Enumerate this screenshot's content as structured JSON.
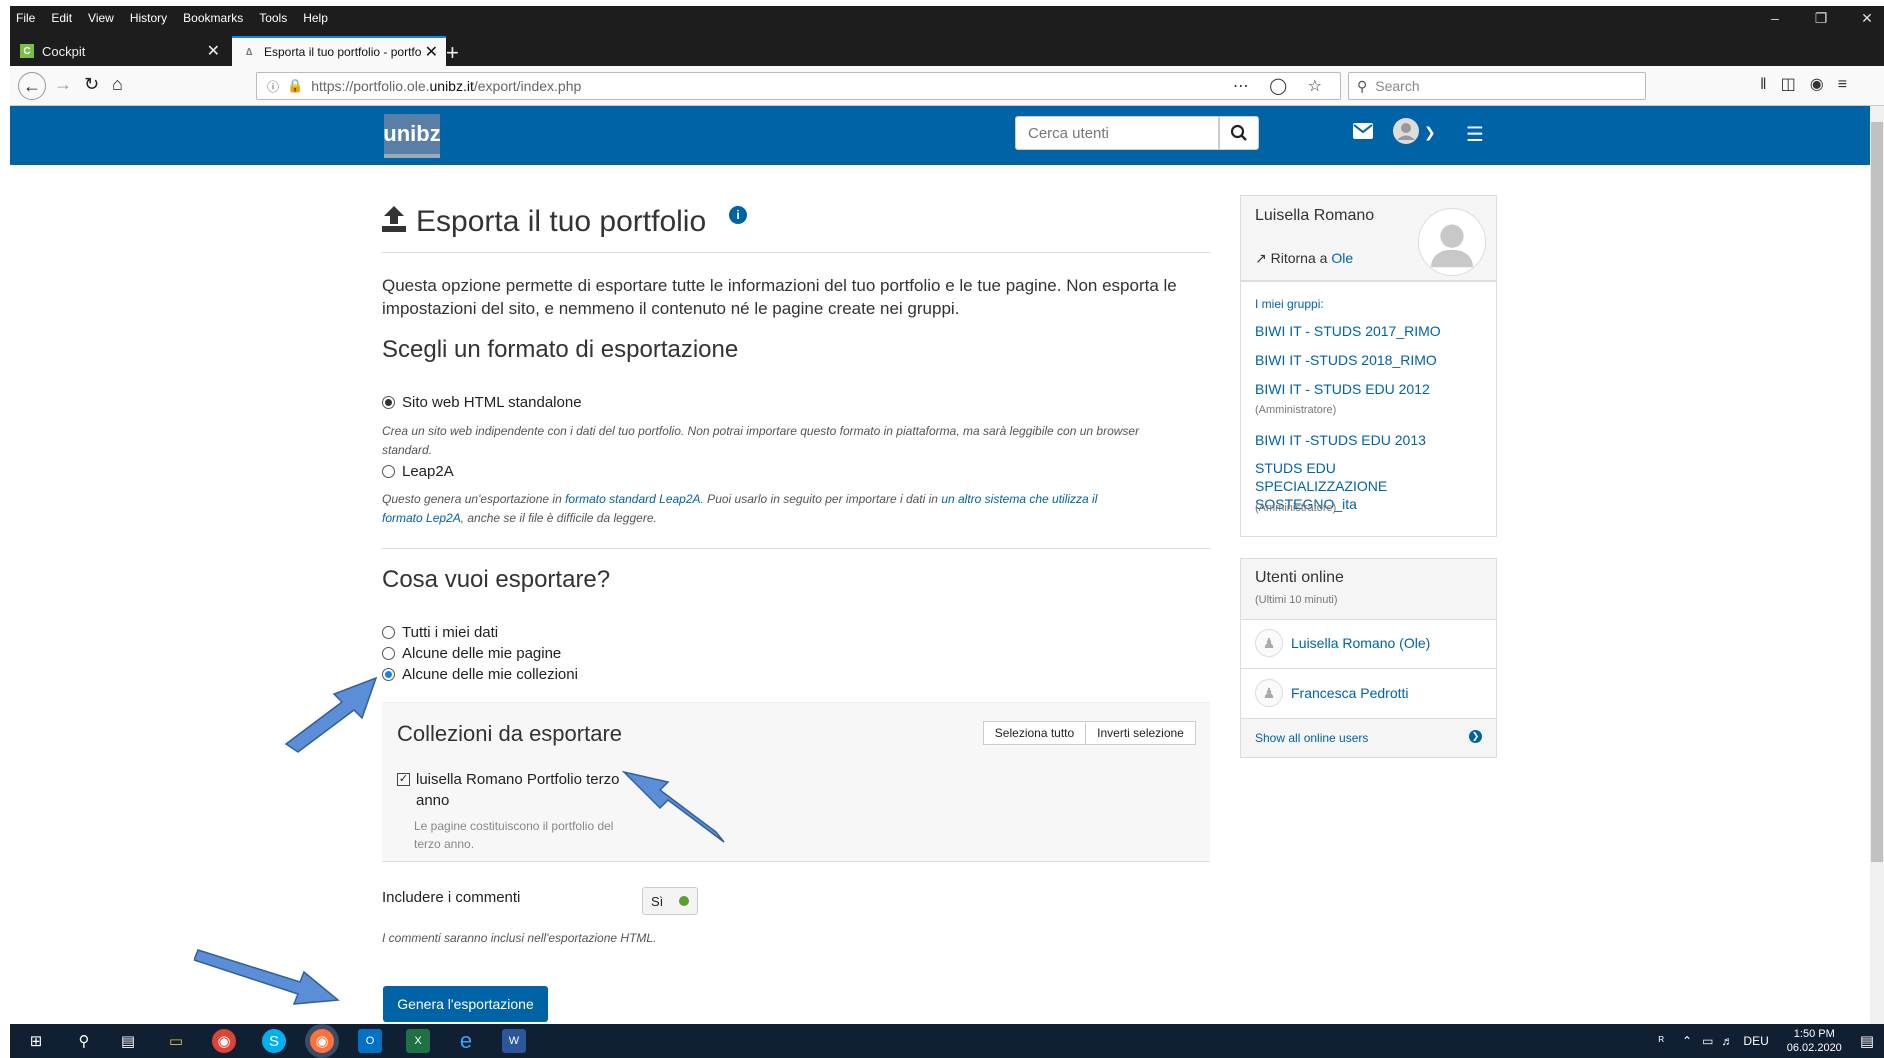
{
  "browser": {
    "menus": [
      "File",
      "Edit",
      "View",
      "History",
      "Bookmarks",
      "Tools",
      "Help"
    ],
    "tabs": [
      {
        "title": "Cockpit"
      },
      {
        "title": "Esporta il tuo portfolio - portfo"
      }
    ],
    "url": {
      "prefix": "https://portfolio.ole.",
      "domain": "unibz.it",
      "path": "/export/index.php"
    },
    "search_placeholder": "Search"
  },
  "site": {
    "logo": "unibz",
    "user_search_placeholder": "Cerca utenti"
  },
  "main": {
    "title": "Esporta il tuo portfolio",
    "intro": "Questa opzione permette di esportare tutte le informazioni del tuo portfolio e le tue pagine. Non esporta le impostazioni del sito, e nemmeno il contenuto né le pagine create nei gruppi.",
    "format_heading": "Scegli un formato di esportazione",
    "format_options": [
      {
        "label": "Sito web HTML standalone",
        "selected": true
      },
      {
        "label": "Leap2A",
        "selected": false
      }
    ],
    "html_desc": "Crea un sito web indipendente con i dati del tuo portfolio. Non potrai importare questo formato in piattaforma, ma sarà leggibile con un browser standard.",
    "leap_desc": {
      "t1": "Questo genera un'esportazione in ",
      "link1": "formato standard Leap2A",
      "t2": ". Puoi usarlo in seguito per importare i dati in ",
      "link2": "un altro sistema che utilizza il formato Lep2A",
      "t3": ", anche se il file è difficile da leggere."
    },
    "what_heading": "Cosa vuoi esportare?",
    "what_options": [
      {
        "label": "Tutti i miei dati",
        "selected": false
      },
      {
        "label": "Alcune delle mie pagine",
        "selected": false
      },
      {
        "label": "Alcune delle mie collezioni",
        "selected": true
      }
    ],
    "collections": {
      "title": "Collezioni da esportare",
      "select_all": "Seleziona tutto",
      "invert": "Inverti selezione",
      "item_label_1": "luisella Romano Portfolio terzo",
      "item_label_2": "anno",
      "item_checked": true,
      "item_desc": "Le pagine costituiscono il portfolio del terzo anno."
    },
    "comments_label": "Includere i commenti",
    "comments_toggle": "Sì",
    "comments_desc": "I commenti saranno inclusi nell'esportazione HTML.",
    "generate_button": "Genera l'esportazione"
  },
  "sidebar": {
    "user_name": "Luisella Romano",
    "return_prefix": "Ritorna a ",
    "return_link": "Ole",
    "groups_label": "I miei gruppi:",
    "groups": [
      {
        "name": "BIWI IT - STUDS 2017_RIMO",
        "note": ""
      },
      {
        "name": "BIWI IT -STUDS 2018_RIMO",
        "note": ""
      },
      {
        "name": "BIWI IT - STUDS EDU 2012",
        "note": "(Amministratore)"
      },
      {
        "name": "BIWI IT -STUDS EDU 2013",
        "note": ""
      },
      {
        "name": "STUDS EDU SPECIALIZZAZIONE SOSTEGNO_ita",
        "note": "(Amministratore)"
      }
    ],
    "online_title": "Utenti online",
    "online_sub": "(Ultimi 10 minuti)",
    "online_users": [
      "Luisella Romano (Ole)",
      "Francesca Pedrotti"
    ],
    "show_all": "Show all online users"
  },
  "taskbar": {
    "lang": "DEU",
    "time": "1:50 PM",
    "date": "06.02.2020"
  },
  "colors": {
    "brand": "#0063a6",
    "accent_green": "#5aa02c"
  }
}
